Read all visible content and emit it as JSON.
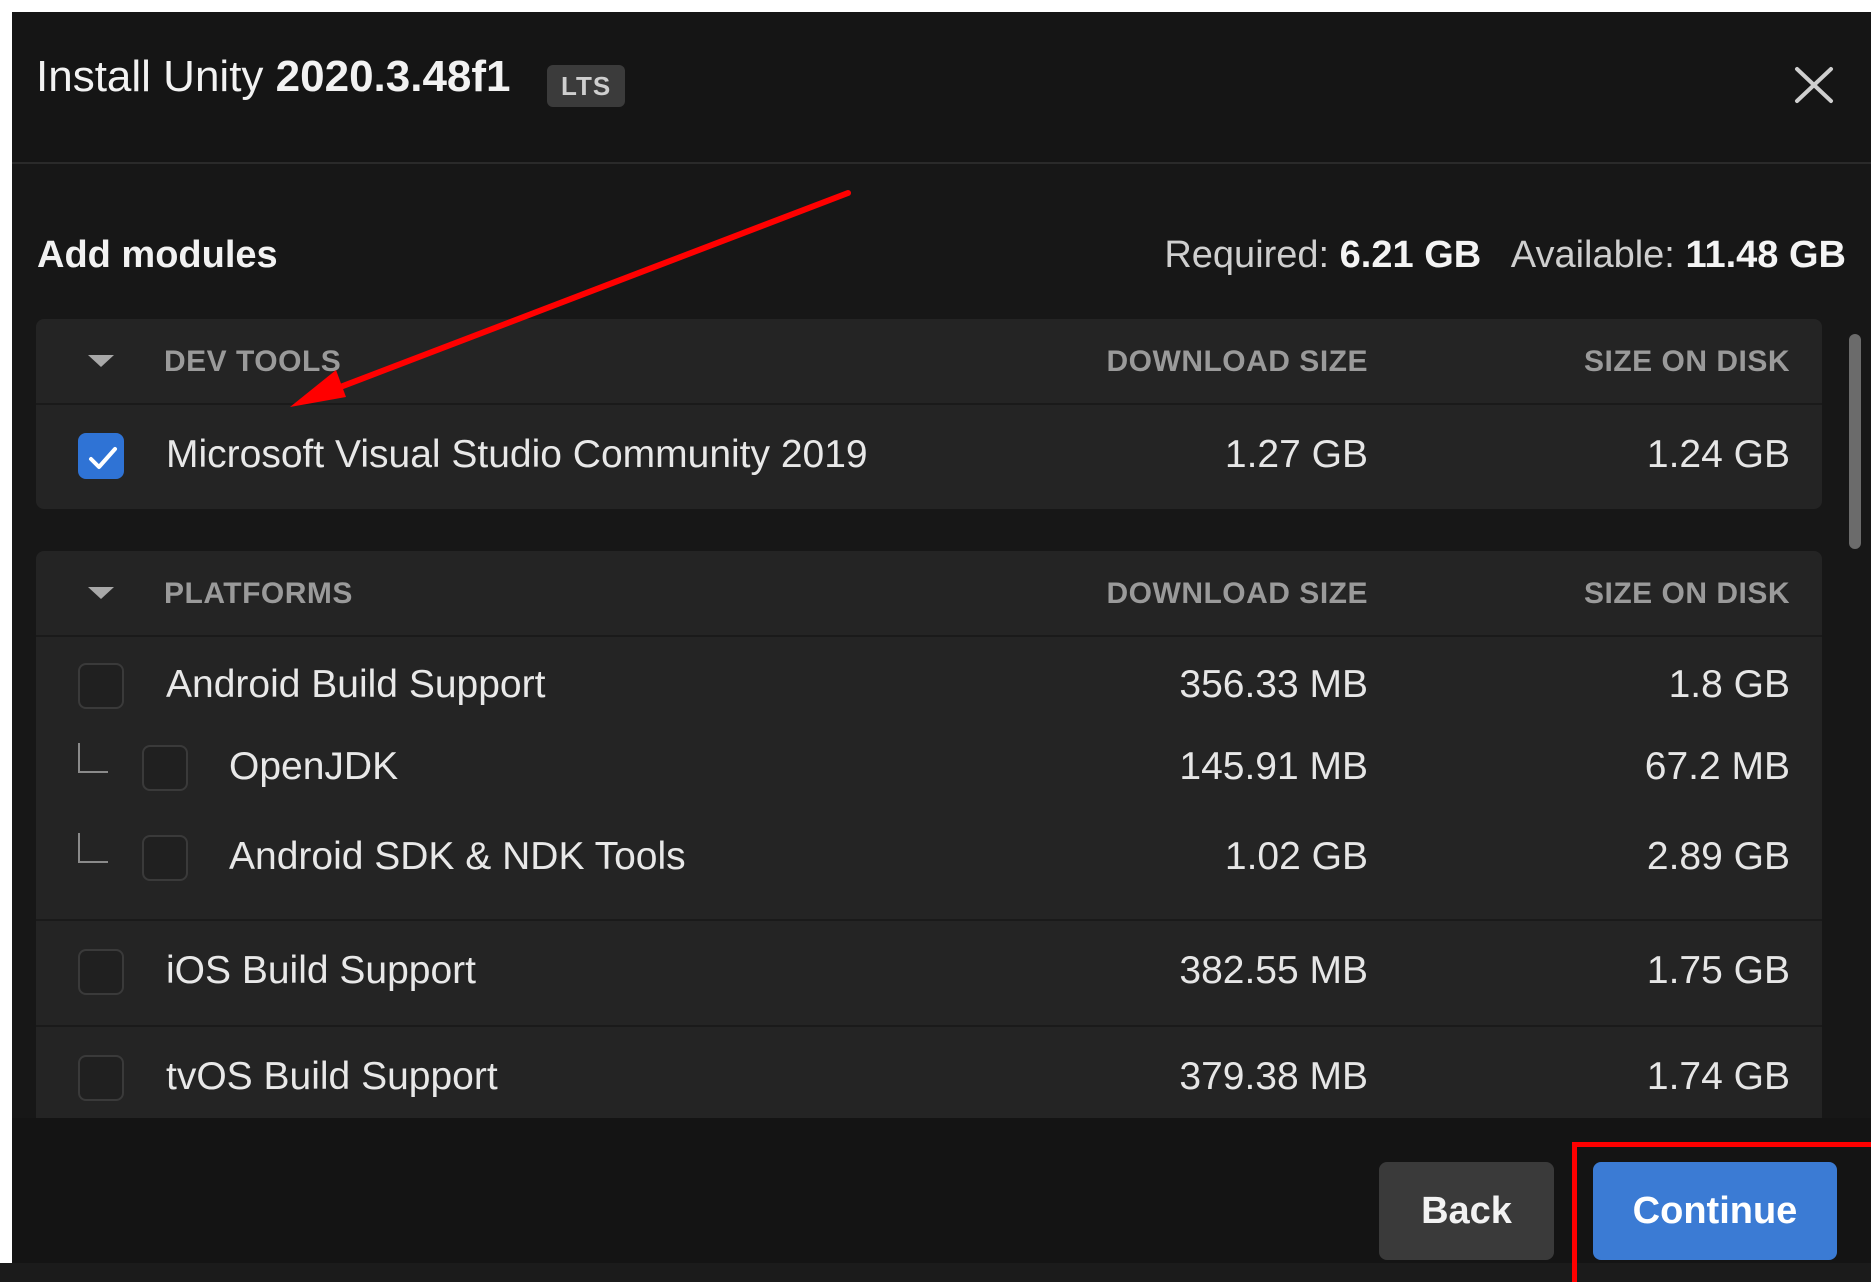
{
  "dialog": {
    "title_prefix": "Install Unity",
    "version": "2020.3.48f1",
    "badge": "LTS"
  },
  "modules": {
    "heading": "Add modules",
    "required_label": "Required:",
    "required_value": "6.21 GB",
    "available_label": "Available:",
    "available_value": "11.48 GB"
  },
  "sections": {
    "dev_tools": {
      "title": "DEV TOOLS",
      "col_download": "DOWNLOAD SIZE",
      "col_disk": "SIZE ON DISK",
      "rows": [
        {
          "name": "Microsoft Visual Studio Community 2019",
          "download": "1.27 GB",
          "disk": "1.24 GB",
          "checked": true
        }
      ]
    },
    "platforms": {
      "title": "PLATFORMS",
      "col_download": "DOWNLOAD SIZE",
      "col_disk": "SIZE ON DISK",
      "rows": [
        {
          "name": "Android Build Support",
          "download": "356.33 MB",
          "disk": "1.8 GB",
          "checked": false
        },
        {
          "name": "OpenJDK",
          "download": "145.91 MB",
          "disk": "67.2 MB",
          "checked": false
        },
        {
          "name": "Android SDK & NDK Tools",
          "download": "1.02 GB",
          "disk": "2.89 GB",
          "checked": false
        },
        {
          "name": "iOS Build Support",
          "download": "382.55 MB",
          "disk": "1.75 GB",
          "checked": false
        },
        {
          "name": "tvOS Build Support",
          "download": "379.38 MB",
          "disk": "1.74 GB",
          "checked": false
        }
      ]
    }
  },
  "footer": {
    "back_label": "Back",
    "continue_label": "Continue"
  },
  "colors": {
    "accent": "#3b7bd4",
    "annotation": "#ff0000"
  }
}
